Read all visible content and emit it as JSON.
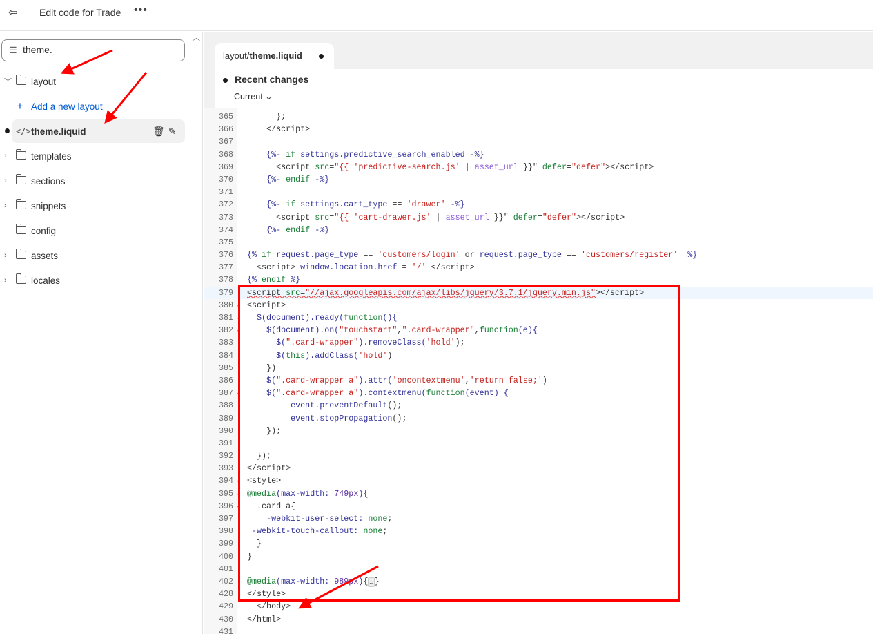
{
  "topbar": {
    "title": "Edit code for Trade",
    "more": "•••",
    "exit_icon": "exit-icon"
  },
  "sidebar": {
    "search_value": "theme.",
    "folders": [
      {
        "label": "layout",
        "expanded": true
      },
      {
        "label": "templates"
      },
      {
        "label": "sections"
      },
      {
        "label": "snippets"
      },
      {
        "label": "config"
      },
      {
        "label": "assets"
      },
      {
        "label": "locales"
      }
    ],
    "add_layout": "Add a new layout",
    "active_file": "theme.liquid"
  },
  "editor": {
    "tab_prefix": "layout/",
    "tab_file": "theme.liquid",
    "recent_changes": "Recent changes",
    "version": "Current",
    "highlight_line": "379",
    "accent_color": "#ff0000",
    "lines": [
      {
        "n": "365",
        "t": [
          [
            "tag",
            "      };"
          ]
        ]
      },
      {
        "n": "366",
        "t": [
          [
            "tag",
            "    </script>"
          ]
        ]
      },
      {
        "n": "367",
        "t": []
      },
      {
        "n": "368",
        "t": [
          [
            "delim",
            "    {%- "
          ],
          [
            "kw",
            "if "
          ],
          [
            "var",
            "settings.predictive_search_enabled "
          ],
          [
            "delim",
            "-%}"
          ]
        ]
      },
      {
        "n": "369",
        "t": [
          [
            "tag",
            "      <script "
          ],
          [
            "attr",
            "src"
          ],
          [
            "tag",
            "="
          ],
          [
            "str",
            "\"{{ "
          ],
          [
            "str",
            "'predictive-search.js'"
          ],
          [
            "tag",
            " | "
          ],
          [
            "filter",
            "asset_url"
          ],
          [
            "tag",
            " }}\" "
          ],
          [
            "attr",
            "defer"
          ],
          [
            "tag",
            "="
          ],
          [
            "str",
            "\"defer\""
          ],
          [
            "tag",
            "></script>"
          ]
        ]
      },
      {
        "n": "370",
        "t": [
          [
            "delim",
            "    {%- "
          ],
          [
            "kw",
            "endif "
          ],
          [
            "delim",
            "-%}"
          ]
        ]
      },
      {
        "n": "371",
        "t": []
      },
      {
        "n": "372",
        "t": [
          [
            "delim",
            "    {%- "
          ],
          [
            "kw",
            "if "
          ],
          [
            "var",
            "settings.cart_type "
          ],
          [
            "tag",
            "== "
          ],
          [
            "str",
            "'drawer'"
          ],
          [
            "delim",
            " -%}"
          ]
        ]
      },
      {
        "n": "373",
        "t": [
          [
            "tag",
            "      <script "
          ],
          [
            "attr",
            "src"
          ],
          [
            "tag",
            "="
          ],
          [
            "str",
            "\"{{ "
          ],
          [
            "str",
            "'cart-drawer.js'"
          ],
          [
            "tag",
            " | "
          ],
          [
            "filter",
            "asset_url"
          ],
          [
            "tag",
            " }}\" "
          ],
          [
            "attr",
            "defer"
          ],
          [
            "tag",
            "="
          ],
          [
            "str",
            "\"defer\""
          ],
          [
            "tag",
            "></script>"
          ]
        ]
      },
      {
        "n": "374",
        "t": [
          [
            "delim",
            "    {%- "
          ],
          [
            "kw",
            "endif "
          ],
          [
            "delim",
            "-%}"
          ]
        ]
      },
      {
        "n": "375",
        "t": []
      },
      {
        "n": "376",
        "t": [
          [
            "delim",
            "{% "
          ],
          [
            "kw",
            "if "
          ],
          [
            "var",
            "request.page_type "
          ],
          [
            "tag",
            "== "
          ],
          [
            "str",
            "'customers/login'"
          ],
          [
            "tag",
            " or "
          ],
          [
            "var",
            "request.page_type "
          ],
          [
            "tag",
            "== "
          ],
          [
            "str",
            "'customers/register'"
          ],
          [
            "delim",
            "  %}"
          ]
        ]
      },
      {
        "n": "377",
        "t": [
          [
            "tag",
            "  <script> "
          ],
          [
            "var",
            "window.location.href"
          ],
          [
            "tag",
            " = "
          ],
          [
            "str",
            "'/'"
          ],
          [
            "tag",
            " </script>"
          ]
        ]
      },
      {
        "n": "378",
        "t": [
          [
            "delim",
            "{% "
          ],
          [
            "kw",
            "endif "
          ],
          [
            "delim",
            "%}"
          ]
        ]
      },
      {
        "n": "379",
        "t": [
          [
            "tag squig",
            "<script "
          ],
          [
            "attr squig",
            "src"
          ],
          [
            "tag squig",
            "="
          ],
          [
            "str squig",
            "\"//ajax.googleapis.com/ajax/libs/jquery/3.7.1/jquery.min.js\""
          ],
          [
            "tag",
            "></script>"
          ]
        ]
      },
      {
        "n": "380",
        "f": true,
        "t": [
          [
            "tag",
            "<script>"
          ]
        ]
      },
      {
        "n": "381",
        "f": true,
        "t": [
          [
            "var",
            "  $(document).ready("
          ],
          [
            "kw",
            "function"
          ],
          [
            "var",
            "(){"
          ]
        ]
      },
      {
        "n": "382",
        "f": true,
        "t": [
          [
            "var",
            "    $(document).on("
          ],
          [
            "str",
            "\"touchstart\""
          ],
          [
            "tag",
            ","
          ],
          [
            "str",
            "\".card-wrapper\""
          ],
          [
            "tag",
            ","
          ],
          [
            "kw",
            "function"
          ],
          [
            "var",
            "(e){"
          ]
        ]
      },
      {
        "n": "383",
        "t": [
          [
            "var",
            "      $("
          ],
          [
            "str",
            "\".card-wrapper\""
          ],
          [
            "var",
            ").removeClass("
          ],
          [
            "str",
            "'hold'"
          ],
          [
            "tag",
            ");"
          ]
        ]
      },
      {
        "n": "384",
        "t": [
          [
            "var",
            "      $("
          ],
          [
            "kw",
            "this"
          ],
          [
            "var",
            ").addClass("
          ],
          [
            "str",
            "'hold'"
          ],
          [
            "tag",
            ")"
          ]
        ]
      },
      {
        "n": "385",
        "t": [
          [
            "tag",
            "    })"
          ]
        ]
      },
      {
        "n": "386",
        "t": [
          [
            "var",
            "    $("
          ],
          [
            "str",
            "\".card-wrapper a\""
          ],
          [
            "var",
            ").attr("
          ],
          [
            "str",
            "'oncontextmenu'"
          ],
          [
            "tag",
            ","
          ],
          [
            "str",
            "'return false;'"
          ],
          [
            "tag",
            ")"
          ]
        ]
      },
      {
        "n": "387",
        "f": true,
        "t": [
          [
            "var",
            "    $("
          ],
          [
            "str",
            "\".card-wrapper a\""
          ],
          [
            "var",
            ").contextmenu("
          ],
          [
            "kw",
            "function"
          ],
          [
            "var",
            "(event) {"
          ]
        ]
      },
      {
        "n": "388",
        "t": [
          [
            "var",
            "         event.preventDefault"
          ],
          [
            "tag",
            "();"
          ]
        ]
      },
      {
        "n": "389",
        "t": [
          [
            "var",
            "         event.stopPropagation"
          ],
          [
            "tag",
            "();"
          ]
        ]
      },
      {
        "n": "390",
        "t": [
          [
            "tag",
            "    });"
          ]
        ]
      },
      {
        "n": "391",
        "t": []
      },
      {
        "n": "392",
        "t": [
          [
            "tag",
            "  });"
          ]
        ]
      },
      {
        "n": "393",
        "t": [
          [
            "tag",
            "</script>"
          ]
        ]
      },
      {
        "n": "394",
        "f": true,
        "t": [
          [
            "tag",
            "<style>"
          ]
        ]
      },
      {
        "n": "395",
        "f": true,
        "t": [
          [
            "kw",
            "@media"
          ],
          [
            "var",
            "(max-width: "
          ],
          [
            "num",
            "749px"
          ],
          [
            "var",
            ")"
          ],
          [
            "tag",
            "{"
          ]
        ]
      },
      {
        "n": "396",
        "f": true,
        "t": [
          [
            "tag",
            "  .card a{"
          ]
        ]
      },
      {
        "n": "397",
        "t": [
          [
            "var",
            "    -webkit-user-select: "
          ],
          [
            "kw",
            "none"
          ],
          [
            "tag",
            ";"
          ]
        ]
      },
      {
        "n": "398",
        "t": [
          [
            "var",
            " -webkit-touch-callout: "
          ],
          [
            "kw",
            "none"
          ],
          [
            "tag",
            ";"
          ]
        ]
      },
      {
        "n": "399",
        "t": [
          [
            "tag",
            "  }"
          ]
        ]
      },
      {
        "n": "400",
        "t": [
          [
            "tag",
            "}"
          ]
        ]
      },
      {
        "n": "401",
        "t": []
      },
      {
        "n": "402",
        "t": [
          [
            "kw",
            "@media"
          ],
          [
            "var",
            "(max-width: "
          ],
          [
            "num",
            "989px"
          ],
          [
            "var",
            ")"
          ],
          [
            "tag",
            "{"
          ],
          [
            "ellip",
            "…"
          ],
          [
            "tag",
            "}"
          ]
        ]
      },
      {
        "n": "428",
        "t": [
          [
            "tag",
            "</style>"
          ]
        ]
      },
      {
        "n": "429",
        "t": [
          [
            "tag",
            "  </body>"
          ]
        ]
      },
      {
        "n": "430",
        "t": [
          [
            "tag",
            "</html>"
          ]
        ]
      },
      {
        "n": "431",
        "t": []
      }
    ]
  }
}
